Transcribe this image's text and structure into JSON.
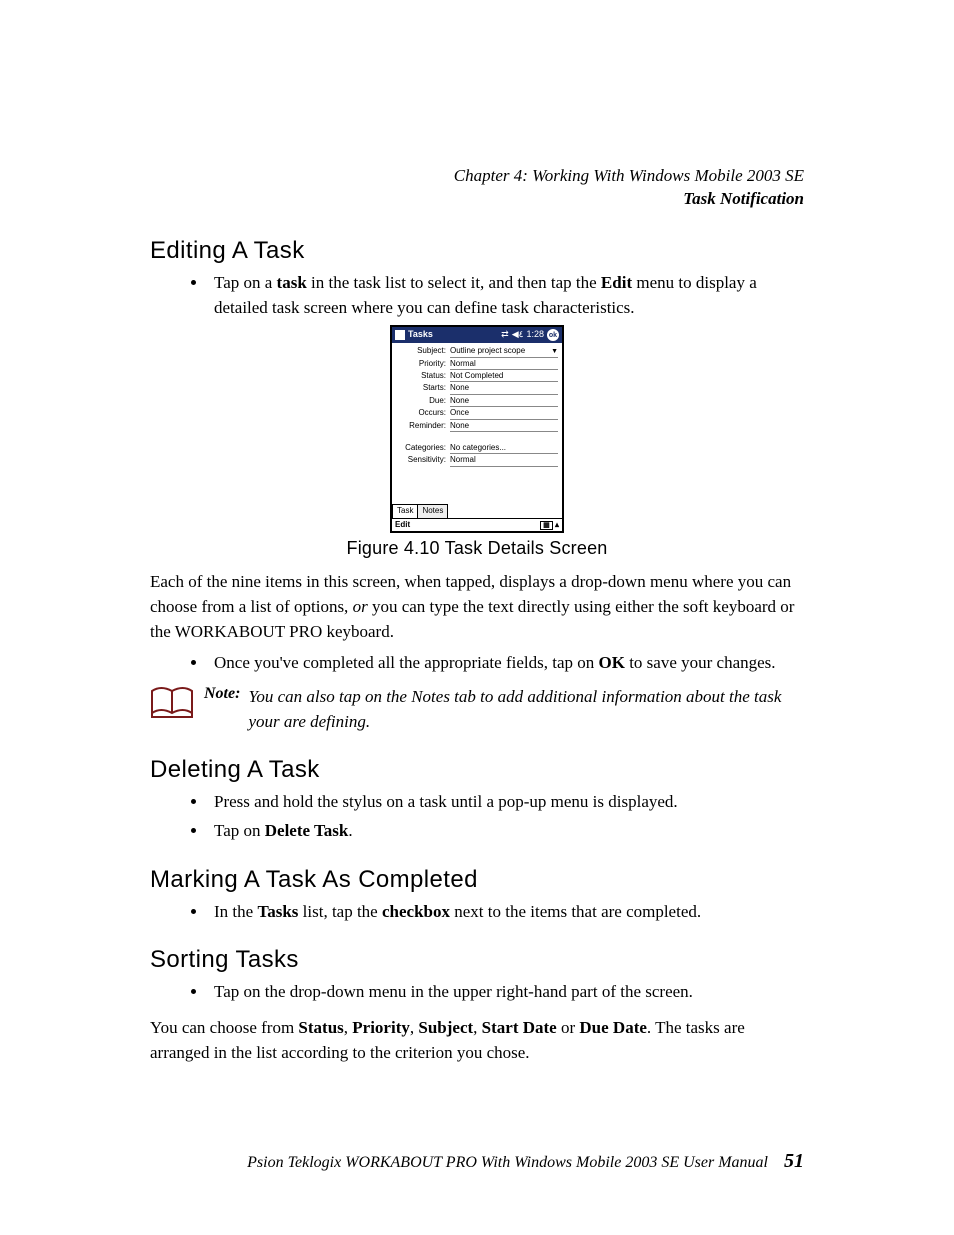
{
  "header": {
    "chapter": "Chapter  4:  Working With Windows Mobile 2003 SE",
    "section": "Task Notification"
  },
  "sec1": {
    "title": "Editing A Task",
    "bullet1_a": "Tap on a ",
    "bullet1_b": "task",
    "bullet1_c": " in the task list to select it, and then tap the ",
    "bullet1_d": "Edit",
    "bullet1_e": " menu to display a detailed task screen where you can define task characteristics."
  },
  "device": {
    "title": "Tasks",
    "time": "1:28",
    "ok": "ok",
    "rows": [
      {
        "label": "Subject:",
        "value": "Outline project scope"
      },
      {
        "label": "Priority:",
        "value": "Normal"
      },
      {
        "label": "Status:",
        "value": "Not Completed"
      },
      {
        "label": "Starts:",
        "value": "None"
      },
      {
        "label": "Due:",
        "value": "None"
      },
      {
        "label": "Occurs:",
        "value": "Once"
      },
      {
        "label": "Reminder:",
        "value": "None"
      },
      {
        "label": "Categories:",
        "value": "No categories..."
      },
      {
        "label": "Sensitivity:",
        "value": "Normal"
      }
    ],
    "tabs": {
      "task": "Task",
      "notes": "Notes"
    },
    "edit": "Edit"
  },
  "figure_caption": "Figure 4.10 Task Details Screen",
  "para_after_fig_a": "Each of the nine items in this screen, when tapped, displays a drop-down menu where you can choose from a list of options, ",
  "para_after_fig_or": "or",
  "para_after_fig_b": " you can type the text directly using either the soft keyboard or the WORKABOUT PRO keyboard.",
  "sec1_bullet2_a": "Once you've completed all the appropriate fields, tap on ",
  "sec1_bullet2_b": "OK",
  "sec1_bullet2_c": " to save your changes.",
  "note": {
    "label": "Note:",
    "text": "You can also tap on the Notes tab to add additional information about the task your are defining."
  },
  "sec2": {
    "title": "Deleting A Task",
    "b1": "Press and hold the stylus on a task until a pop-up menu is displayed.",
    "b2_a": "Tap on ",
    "b2_b": "Delete Task",
    "b2_c": "."
  },
  "sec3": {
    "title": "Marking A Task As Completed",
    "b1_a": "In the ",
    "b1_b": "Tasks",
    "b1_c": " list, tap the ",
    "b1_d": "checkbox",
    "b1_e": " next to the items that are completed."
  },
  "sec4": {
    "title": "Sorting Tasks",
    "b1": "Tap on the drop-down menu in the upper right-hand part of the screen.",
    "p_a": "You can choose from ",
    "p_b": "Status",
    "p_c": ", ",
    "p_d": "Priority",
    "p_e": ", ",
    "p_f": "Subject",
    "p_g": ", ",
    "p_h": "Start Date",
    "p_i": " or ",
    "p_j": "Due Date",
    "p_k": ". The tasks are arranged in the list according to the criterion you chose."
  },
  "footer": {
    "text": "Psion Teklogix WORKABOUT PRO With Windows Mobile 2003 SE User Manual",
    "page": "51"
  }
}
